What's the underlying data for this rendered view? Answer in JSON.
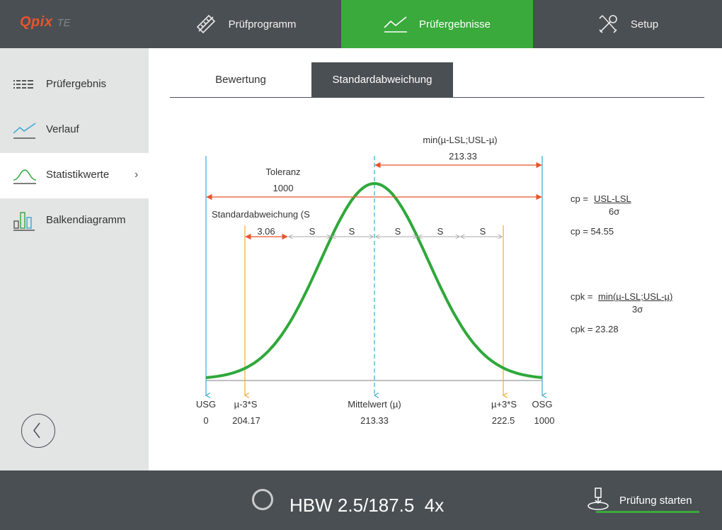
{
  "logo": {
    "brand": "Qpix",
    "suffix": "TE"
  },
  "nav": {
    "tabs": [
      {
        "label": "Prüfprogramm"
      },
      {
        "label": "Prüfergebnisse"
      },
      {
        "label": "Setup"
      }
    ]
  },
  "sidebar": {
    "items": [
      {
        "label": "Prüfergebnis"
      },
      {
        "label": "Verlauf"
      },
      {
        "label": "Statistikwerte"
      },
      {
        "label": "Balkendiagramm"
      }
    ],
    "chevron": "›"
  },
  "subtabs": [
    {
      "label": "Bewertung"
    },
    {
      "label": "Standardabweichung"
    }
  ],
  "chart": {
    "min_label": "min(µ-LSL;USL-µ)",
    "min_value": "213.33",
    "tol_label": "Toleranz",
    "tol_value": "1000",
    "std_label": "Standardabweichung (S",
    "std_value": "3.06",
    "s_label": "S",
    "markers": {
      "usg": {
        "label": "USG",
        "value": "0"
      },
      "lower": {
        "label": "µ-3*S",
        "value": "204.17"
      },
      "mean": {
        "label": "Mittelwert (µ)",
        "value": "213.33"
      },
      "upper": {
        "label": "µ+3*S",
        "value": "222.5"
      },
      "osg": {
        "label": "OSG",
        "value": "1000"
      }
    },
    "colors": {
      "curve": "#2fa83a",
      "limits": "#3aa9d4",
      "sigma": "#f0ad2c",
      "dimension": "#e8552d",
      "grid": "#bbbbbb"
    }
  },
  "formulas": {
    "cp_prefix": "cp =",
    "cp_numerator": "USL-LSL",
    "cp_denominator": "6σ",
    "cp_result": "cp =  54.55",
    "cpk_prefix": "cpk =",
    "cpk_numerator": "min(µ-LSL;USL-µ)",
    "cpk_denominator": "3σ",
    "cpk_result": "cpk = 23.28"
  },
  "bottom": {
    "method": "HBW 2.5/187.5  4x",
    "start_label": "Prüfung starten"
  }
}
